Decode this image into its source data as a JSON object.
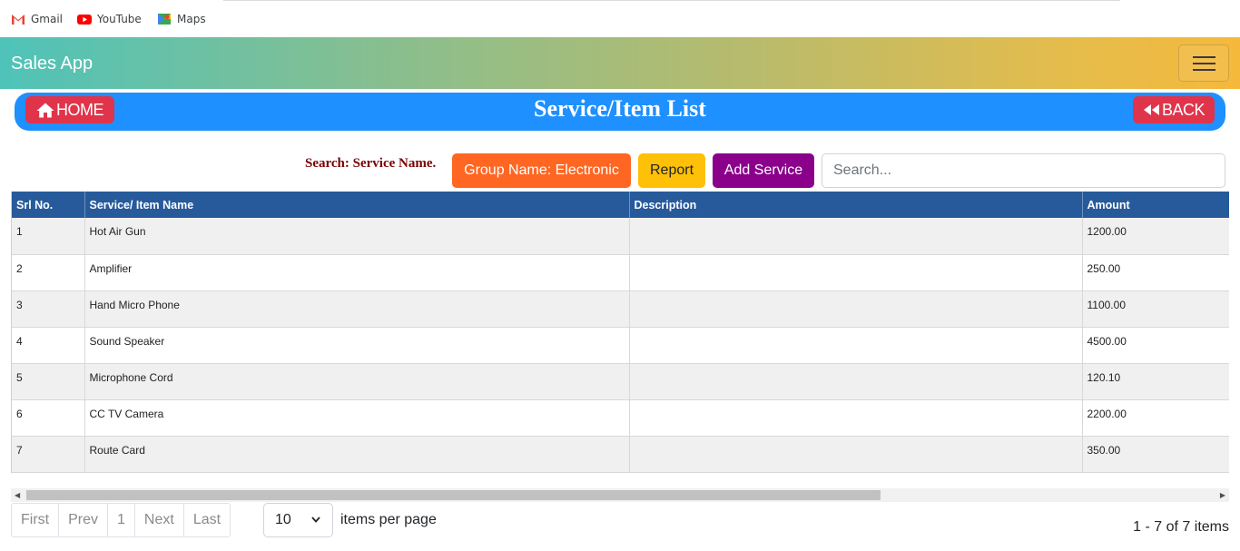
{
  "bookmarks": [
    {
      "label": "Gmail",
      "icon": "gmail-icon"
    },
    {
      "label": "YouTube",
      "icon": "youtube-icon"
    },
    {
      "label": "Maps",
      "icon": "maps-icon"
    }
  ],
  "navbar": {
    "brand": "Sales App",
    "toggler_icon": "hamburger-icon"
  },
  "titlebar": {
    "home_label": "HOME",
    "back_label": "BACK",
    "title": "Service/Item List"
  },
  "toolbar": {
    "search_label": "Search: Service Name.",
    "group_button": "Group Name: Electronic",
    "report_button": "Report",
    "add_button": "Add Service",
    "search_placeholder": "Search..."
  },
  "table": {
    "headers": [
      "Srl No.",
      "Service/ Item Name",
      "Description",
      "Amount"
    ],
    "rows": [
      {
        "srl": "1",
        "name": "Hot Air Gun",
        "description": "",
        "amount": "1200.00"
      },
      {
        "srl": "2",
        "name": "Amplifier",
        "description": "",
        "amount": "250.00"
      },
      {
        "srl": "3",
        "name": "Hand Micro Phone",
        "description": "",
        "amount": "1100.00"
      },
      {
        "srl": "4",
        "name": "Sound Speaker",
        "description": "",
        "amount": "4500.00"
      },
      {
        "srl": "5",
        "name": "Microphone Cord",
        "description": "",
        "amount": "120.10"
      },
      {
        "srl": "6",
        "name": "CC TV Camera",
        "description": "",
        "amount": "2200.00"
      },
      {
        "srl": "7",
        "name": "Route Card",
        "description": "",
        "amount": "350.00"
      }
    ]
  },
  "pager": {
    "first": "First",
    "prev": "Prev",
    "page": "1",
    "next": "Next",
    "last": "Last",
    "page_size": "10",
    "items_per_page": "items per page",
    "info": "1 - 7 of 7 items"
  },
  "colors": {
    "titlebar": "#1e90ff",
    "danger": "#e0344a",
    "group_btn": "#ff6622",
    "report_btn": "#ffc107",
    "add_btn": "#8b008b",
    "grid_header": "#275a9a"
  }
}
